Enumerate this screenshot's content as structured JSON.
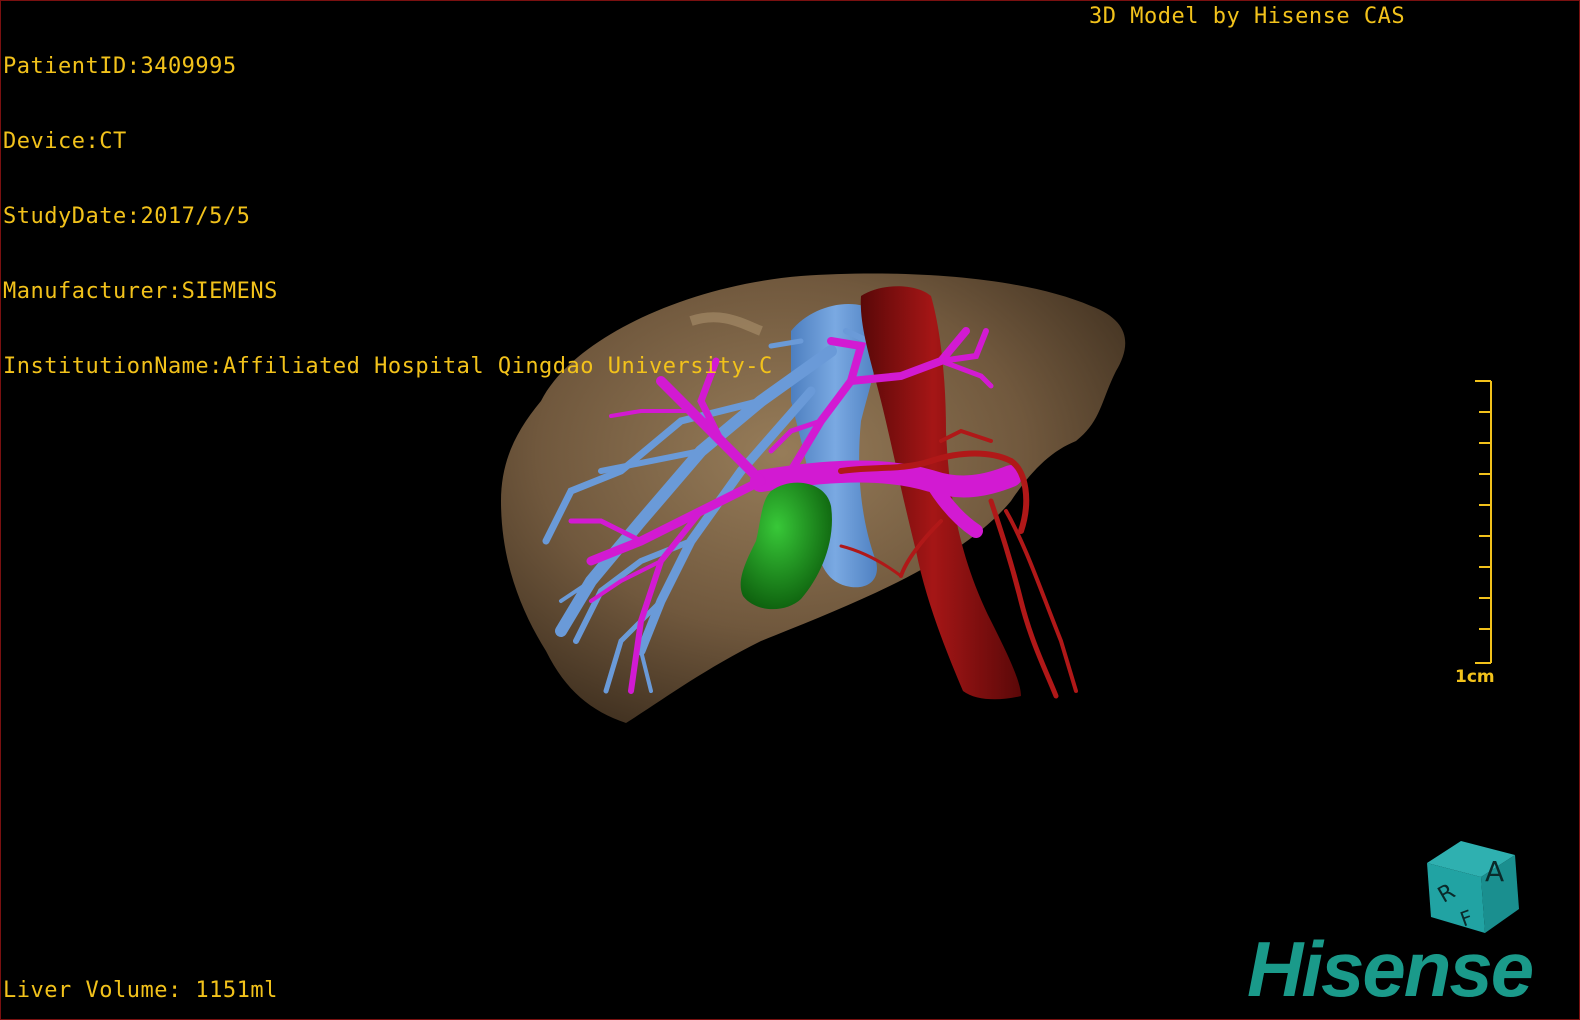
{
  "patient_info": {
    "patient_id": "PatientID:3409995",
    "device": "Device:CT",
    "study_date": "StudyDate:2017/5/5",
    "manufacturer": "Manufacturer:SIEMENS",
    "institution": "InstitutionName:Affiliated Hospital Qingdao University-C"
  },
  "model_credit": "3D Model by Hisense CAS",
  "liver_volume": "Liver Volume: 1151ml",
  "scale_bar": {
    "label": "1cm"
  },
  "orientation_cube": {
    "front_letter": "A",
    "side_letter": "R",
    "bottom_letter": "F"
  },
  "brand": "Hisense",
  "colors": {
    "overlay_text": "#f2c21b",
    "liver": "#8a6d4a",
    "portal_vein": "#d21ad2",
    "hepatic_vein": "#5a8fd0",
    "artery": "#a01414",
    "gallbladder": "#1a9a1a",
    "brand": "#1a9a8a"
  }
}
